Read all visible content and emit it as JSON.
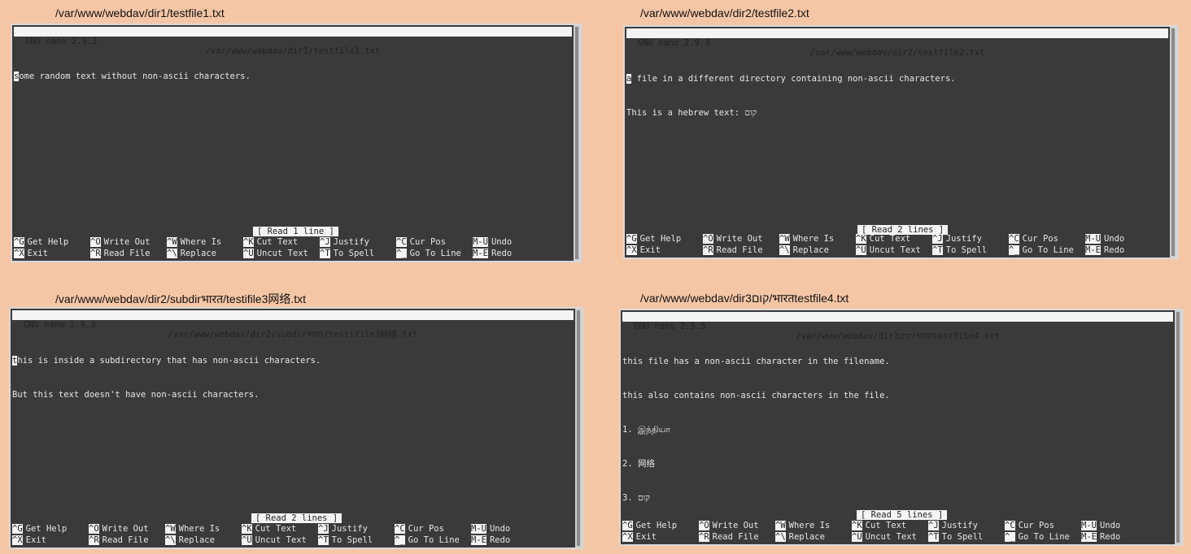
{
  "panels": [
    {
      "caption": "/var/www/webdav/dir1/testfile1.txt",
      "version": "GNU nano 2.9.3",
      "title_path": "/var/www/webdav/dir1/testfile1.txt",
      "cursor_char": "s",
      "first_line_rest": "ome random text without non-ascii characters.",
      "lines": [],
      "status": "[ Read 1 line ]"
    },
    {
      "caption": "/var/www/webdav/dir2/testfile2.txt",
      "version": "GNU nano 2.9.3",
      "title_path": "/var/www/webdav/dir2/testfile2.txt",
      "cursor_char": "a",
      "first_line_rest": " file in a different directory containing non-ascii characters.",
      "lines": [
        "This is a hebrew text: קום"
      ],
      "status": "[ Read 2 lines ]"
    },
    {
      "caption": "/var/www/webdav/dir2/subdirभारत/testifile3网络.txt",
      "version": "GNU nano 2.9.3",
      "title_path": "/var/www/webdav/dir2/subdirभारत/testifile3网络.txt",
      "cursor_char": "t",
      "first_line_rest": "his is inside a subdirectory that has non-ascii characters.",
      "lines": [
        "But this text doesn't have non-ascii characters."
      ],
      "status": "[ Read 2 lines ]"
    },
    {
      "caption": "/var/www/webdav/dir3קום/भारतtestfile4.txt",
      "version": "GNU nano 2.9.3",
      "title_path": "/var/www/webdav/dir3קום/भारतtestfile4.txt",
      "cursor_char": "",
      "first_line_rest": "this file has a non-ascii character in the filename.",
      "lines": [
        "this also contains non-ascii characters in the file.",
        "1. இந்தியா",
        "2. 网络",
        "3. קום"
      ],
      "status": "[ Read 5 lines ]"
    }
  ],
  "shortcuts": [
    {
      "key": "^G",
      "label": "Get Help"
    },
    {
      "key": "^X",
      "label": "Exit"
    },
    {
      "key": "^O",
      "label": "Write Out"
    },
    {
      "key": "^R",
      "label": "Read File"
    },
    {
      "key": "^W",
      "label": "Where Is"
    },
    {
      "key": "^\\",
      "label": "Replace"
    },
    {
      "key": "^K",
      "label": "Cut Text"
    },
    {
      "key": "^U",
      "label": "Uncut Text"
    },
    {
      "key": "^J",
      "label": "Justify"
    },
    {
      "key": "^T",
      "label": "To Spell"
    },
    {
      "key": "^C",
      "label": "Cur Pos"
    },
    {
      "key": "^_",
      "label": "Go To Line"
    },
    {
      "key": "M-U",
      "label": "Undo"
    },
    {
      "key": "M-E",
      "label": "Redo"
    }
  ],
  "colors": {
    "background": "#f5c6a6",
    "terminal": "#3a3a3a",
    "bar": "#f4f4f4"
  }
}
